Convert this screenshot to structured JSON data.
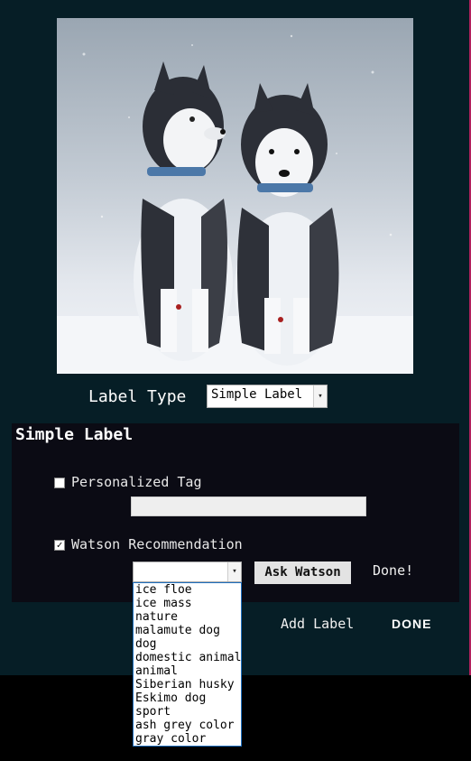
{
  "label_type": {
    "caption": "Label Type",
    "selected": "Simple Label"
  },
  "panel": {
    "title": "Simple Label",
    "personalized": {
      "label": "Personalized Tag",
      "checked": false,
      "value": ""
    },
    "watson": {
      "label": "Watson Recommendation",
      "checked": true,
      "select_value": "",
      "ask_button": "Ask Watson",
      "status": "Done!"
    }
  },
  "footer": {
    "add_label": "Add Label",
    "done_logo": "DONE"
  },
  "dropdown_options": [
    "ice floe",
    "ice mass",
    "nature",
    "malamute dog",
    "dog",
    "domestic animal",
    "animal",
    "Siberian husky dog",
    "Eskimo dog",
    "sport",
    "ash grey color",
    "gray color"
  ],
  "colors": {
    "app_background": "#061e26",
    "panel_background": "#0b0b14",
    "accent_border": "#b0205c",
    "dropdown_border": "#1e6fbf"
  }
}
